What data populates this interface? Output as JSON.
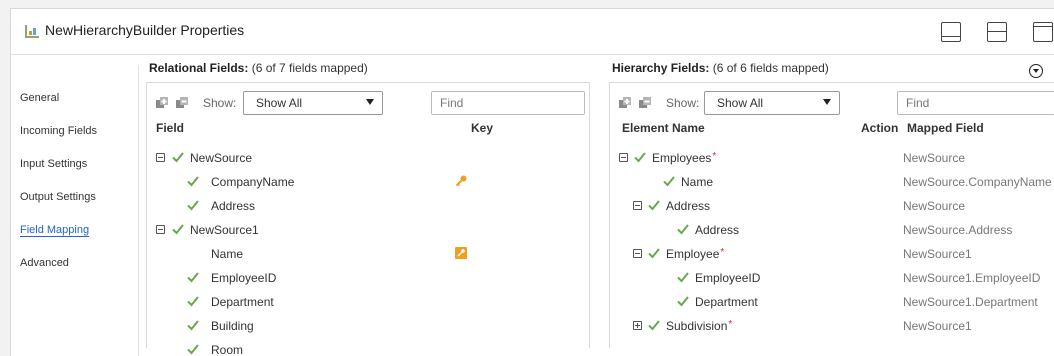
{
  "window": {
    "title": "NewHierarchyBuilder Properties",
    "layout_buttons": [
      "layout-bottom-icon",
      "layout-split-icon",
      "layout-top-icon"
    ]
  },
  "sidebar": {
    "items": [
      {
        "label": "General",
        "active": false
      },
      {
        "label": "Incoming Fields",
        "active": false
      },
      {
        "label": "Input Settings",
        "active": false
      },
      {
        "label": "Output Settings",
        "active": false
      },
      {
        "label": "Field Mapping",
        "active": true
      },
      {
        "label": "Advanced",
        "active": false
      }
    ]
  },
  "relational": {
    "title": "Relational Fields:",
    "summary": "(6 of 7 fields mapped)",
    "show_label": "Show:",
    "show_value": "Show All",
    "find_placeholder": "Find",
    "col_field": "Field",
    "col_key": "Key",
    "rows": [
      {
        "name": "NewSource",
        "level": 0,
        "toggle": "minus",
        "check": true,
        "key": ""
      },
      {
        "name": "CompanyName",
        "level": 1,
        "check": true,
        "key": "key"
      },
      {
        "name": "Address",
        "level": 1,
        "check": true,
        "key": ""
      },
      {
        "name": "NewSource1",
        "level": 0,
        "toggle": "minus",
        "check": true,
        "key": ""
      },
      {
        "name": "Name",
        "level": 1,
        "check": false,
        "key": "key-box"
      },
      {
        "name": "EmployeeID",
        "level": 1,
        "check": true,
        "key": ""
      },
      {
        "name": "Department",
        "level": 1,
        "check": true,
        "key": ""
      },
      {
        "name": "Building",
        "level": 1,
        "check": true,
        "key": ""
      },
      {
        "name": "Room",
        "level": 1,
        "check": true,
        "key": ""
      }
    ]
  },
  "hierarchy": {
    "title": "Hierarchy Fields:",
    "summary": "(6 of 6 fields mapped)",
    "show_label": "Show:",
    "show_value": "Show All",
    "find_placeholder": "Find",
    "col_element": "Element Name",
    "col_action": "Action",
    "col_mapped": "Mapped Field",
    "rows": [
      {
        "name": "Employees",
        "level": 0,
        "toggle": "minus",
        "required": true,
        "mapped": "NewSource"
      },
      {
        "name": "Name",
        "level": 1,
        "required": false,
        "mapped": "NewSource.CompanyName"
      },
      {
        "name": "Address",
        "level": 1,
        "toggle": "minus",
        "required": false,
        "mapped": "NewSource"
      },
      {
        "name": "Address",
        "level": 2,
        "required": false,
        "mapped": "NewSource.Address"
      },
      {
        "name": "Employee",
        "level": 1,
        "toggle": "minus",
        "required": true,
        "mapped": "NewSource1"
      },
      {
        "name": "EmployeeID",
        "level": 2,
        "required": false,
        "mapped": "NewSource1.EmployeeID"
      },
      {
        "name": "Department",
        "level": 2,
        "required": false,
        "mapped": "NewSource1.Department"
      },
      {
        "name": "Subdivision",
        "level": 1,
        "toggle": "plus",
        "required": true,
        "mapped": "NewSource1"
      }
    ]
  },
  "colors": {
    "check": "#6aa84f",
    "key": "#f0a020",
    "required": "#d93025",
    "active_link": "#2563c7"
  }
}
